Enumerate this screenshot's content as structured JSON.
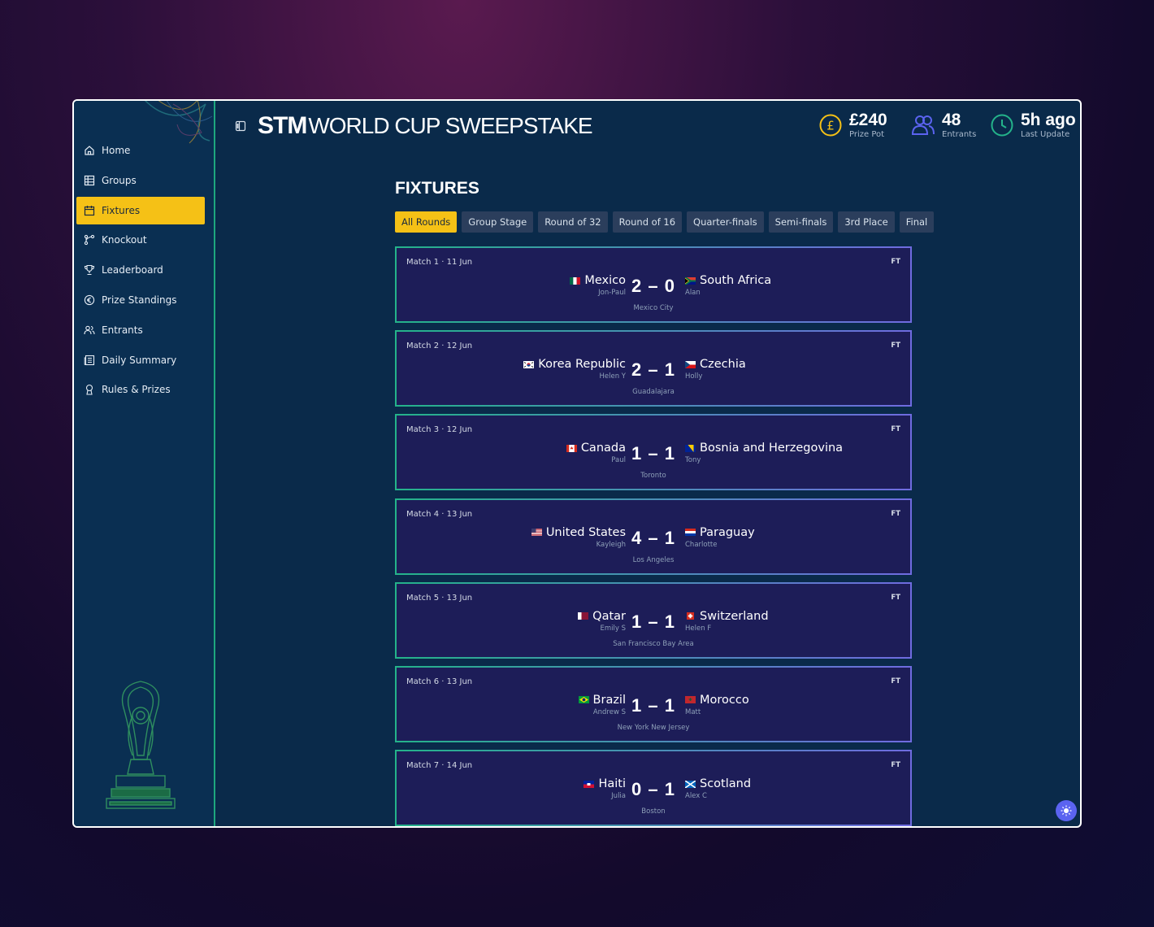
{
  "app": {
    "logo_bold": "STM",
    "logo_rest": "WORLD CUP SWEEPSTAKE"
  },
  "stats": [
    {
      "value": "£240",
      "label": "Prize Pot",
      "icon": "pound-coin-icon",
      "color": "#f5c116"
    },
    {
      "value": "48",
      "label": "Entrants",
      "icon": "users-icon",
      "color": "#5b63f0"
    },
    {
      "value": "5h ago",
      "label": "Last Update",
      "icon": "clock-icon",
      "color": "#24b38a"
    }
  ],
  "sidebar": {
    "items": [
      {
        "label": "Home",
        "icon": "home-icon"
      },
      {
        "label": "Groups",
        "icon": "grid-icon"
      },
      {
        "label": "Fixtures",
        "icon": "calendar-icon",
        "active": true
      },
      {
        "label": "Knockout",
        "icon": "bracket-icon"
      },
      {
        "label": "Leaderboard",
        "icon": "trophy-icon"
      },
      {
        "label": "Prize Standings",
        "icon": "euro-icon"
      },
      {
        "label": "Entrants",
        "icon": "users-icon"
      },
      {
        "label": "Daily Summary",
        "icon": "newspaper-icon"
      },
      {
        "label": "Rules & Prizes",
        "icon": "award-icon"
      }
    ]
  },
  "main": {
    "title": "FIXTURES",
    "tabs": [
      "All Rounds",
      "Group Stage",
      "Round of 32",
      "Round of 16",
      "Quarter-finals",
      "Semi-finals",
      "3rd Place",
      "Final"
    ],
    "active_tab": "All Rounds"
  },
  "fixtures": [
    {
      "meta": "Match 1 · 11 Jun",
      "status": "FT",
      "home": "Mexico",
      "home_entrant": "Jon-Paul",
      "away": "South Africa",
      "away_entrant": "Alan",
      "score": "2 – 0",
      "venue": "Mexico City"
    },
    {
      "meta": "Match 2 · 12 Jun",
      "status": "FT",
      "home": "Korea Republic",
      "home_entrant": "Helen Y",
      "away": "Czechia",
      "away_entrant": "Holly",
      "score": "2 – 1",
      "venue": "Guadalajara"
    },
    {
      "meta": "Match 3 · 12 Jun",
      "status": "FT",
      "home": "Canada",
      "home_entrant": "Paul",
      "away": "Bosnia and Herzegovina",
      "away_entrant": "Tony",
      "score": "1 – 1",
      "venue": "Toronto"
    },
    {
      "meta": "Match 4 · 13 Jun",
      "status": "FT",
      "home": "United States",
      "home_entrant": "Kayleigh",
      "away": "Paraguay",
      "away_entrant": "Charlotte",
      "score": "4 – 1",
      "venue": "Los Angeles"
    },
    {
      "meta": "Match 5 · 13 Jun",
      "status": "FT",
      "home": "Qatar",
      "home_entrant": "Emily S",
      "away": "Switzerland",
      "away_entrant": "Helen F",
      "score": "1 – 1",
      "venue": "San Francisco Bay Area"
    },
    {
      "meta": "Match 6 · 13 Jun",
      "status": "FT",
      "home": "Brazil",
      "home_entrant": "Andrew S",
      "away": "Morocco",
      "away_entrant": "Matt",
      "score": "1 – 1",
      "venue": "New York New Jersey"
    },
    {
      "meta": "Match 7 · 14 Jun",
      "status": "FT",
      "home": "Haiti",
      "home_entrant": "Julia",
      "away": "Scotland",
      "away_entrant": "Alex C",
      "score": "0 – 1",
      "venue": "Boston"
    }
  ],
  "colors": {
    "accent": "#f5c116",
    "border_green": "#24b38a",
    "border_purple": "#6f6be0",
    "card_bg": "#1d1d58",
    "panel_bg": "#0a2a4a"
  }
}
